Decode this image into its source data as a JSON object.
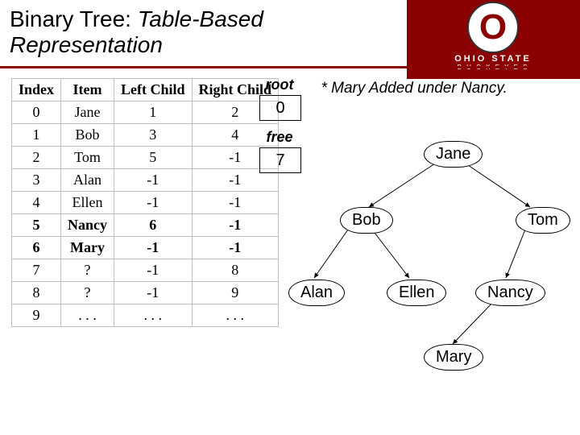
{
  "title": {
    "plain": "Binary Tree: ",
    "italic": "Table-Based",
    "line2": "Representation"
  },
  "logo": {
    "letter": "O",
    "main": "OHIO STATE",
    "sub": "B U C K E Y E S"
  },
  "table": {
    "headers": [
      "Index",
      "Item",
      "Left Child",
      "Right Child"
    ],
    "rows": [
      {
        "cells": [
          "0",
          "Jane",
          "1",
          "2"
        ],
        "bold": false
      },
      {
        "cells": [
          "1",
          "Bob",
          "3",
          "4"
        ],
        "bold": false
      },
      {
        "cells": [
          "2",
          "Tom",
          "5",
          "-1"
        ],
        "bold": false
      },
      {
        "cells": [
          "3",
          "Alan",
          "-1",
          "-1"
        ],
        "bold": false
      },
      {
        "cells": [
          "4",
          "Ellen",
          "-1",
          "-1"
        ],
        "bold": false
      },
      {
        "cells": [
          "5",
          "Nancy",
          "6",
          "-1"
        ],
        "bold": true
      },
      {
        "cells": [
          "6",
          "Mary",
          "-1",
          "-1"
        ],
        "bold": true
      },
      {
        "cells": [
          "7",
          "?",
          "-1",
          "8"
        ],
        "bold": false
      },
      {
        "cells": [
          "8",
          "?",
          "-1",
          "9"
        ],
        "bold": false
      },
      {
        "cells": [
          "9",
          ". . .",
          ". . .",
          ". . ."
        ],
        "bold": false
      }
    ]
  },
  "pointers": {
    "root_label": "root",
    "root_value": "0",
    "free_label": "free",
    "free_value": "7"
  },
  "note": "* Mary Added under Nancy.",
  "tree_nodes": {
    "jane": "Jane",
    "bob": "Bob",
    "tom": "Tom",
    "alan": "Alan",
    "ellen": "Ellen",
    "nancy": "Nancy",
    "mary": "Mary"
  }
}
